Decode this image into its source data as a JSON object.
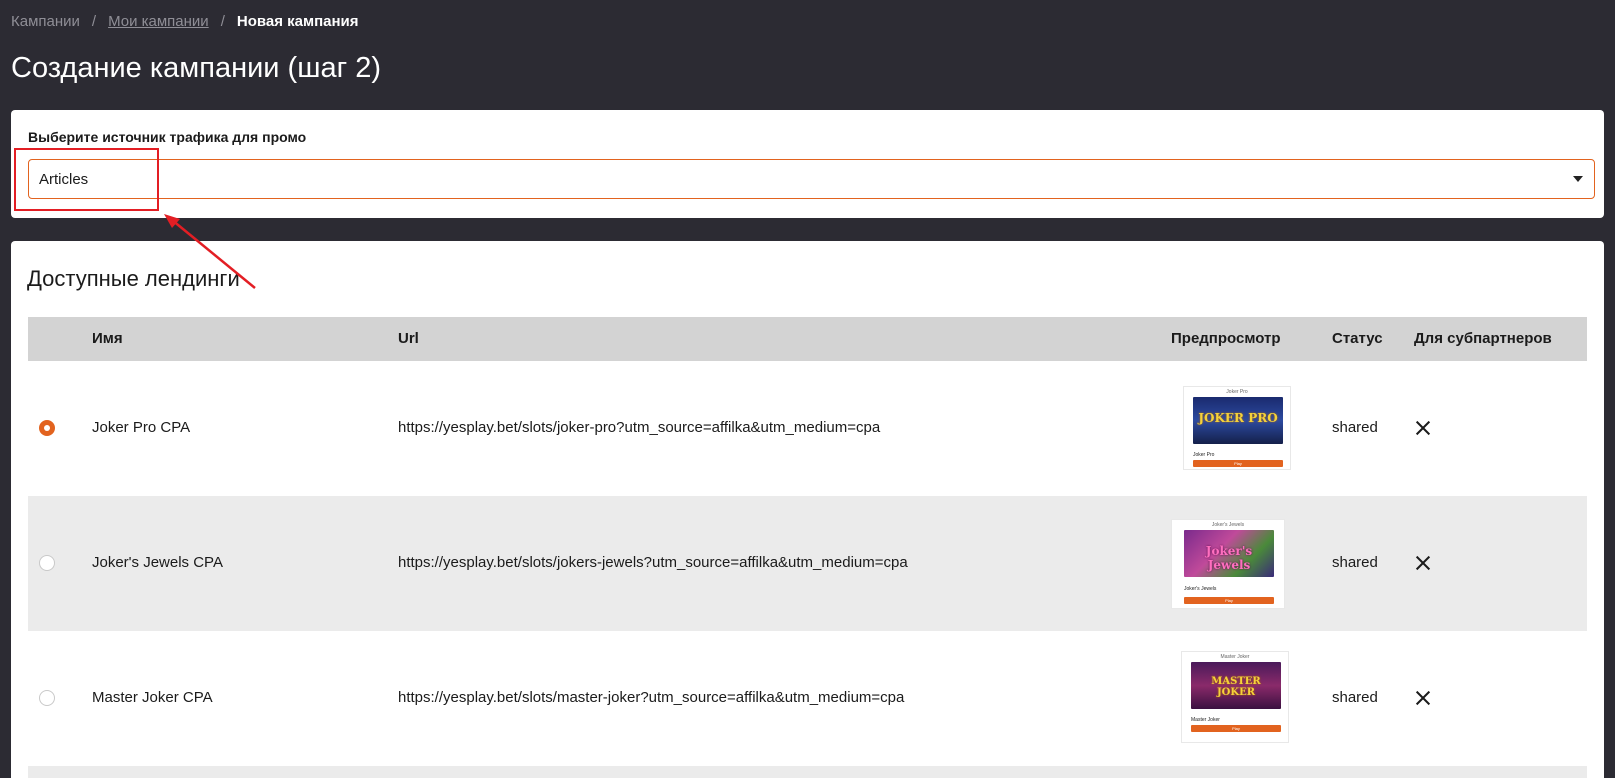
{
  "breadcrumb": {
    "items": [
      "Кампании",
      "Мои кампании",
      "Новая кампания"
    ],
    "separator": "/"
  },
  "page_title": "Создание кампании (шаг 2)",
  "traffic_source": {
    "label": "Выберите источник трафика для промо",
    "selected_value": "Articles",
    "accent_color": "#e2631f"
  },
  "landings": {
    "title": "Доступные лендинги",
    "columns": [
      "Имя",
      "Url",
      "Предпросмотр",
      "Статус",
      "Для субпартнеров"
    ],
    "rows": [
      {
        "selected": true,
        "name": "Joker Pro CPA",
        "url": "https://yesplay.bet/slots/joker-pro?utm_source=affilka&utm_medium=cpa",
        "preview": {
          "title": "Joker Pro",
          "name": "Joker Pro",
          "button": "Play",
          "logo": "JOKER PRO"
        },
        "status": "shared",
        "subpartners_icon": "close-icon"
      },
      {
        "selected": false,
        "name": "Joker's Jewels CPA",
        "url": "https://yesplay.bet/slots/jokers-jewels?utm_source=affilka&utm_medium=cpa",
        "preview": {
          "title": "Joker's Jewels",
          "name": "Joker's Jewels",
          "button": "Play",
          "logo": "Joker's Jewels"
        },
        "status": "shared",
        "subpartners_icon": "close-icon"
      },
      {
        "selected": false,
        "name": "Master Joker CPA",
        "url": "https://yesplay.bet/slots/master-joker?utm_source=affilka&utm_medium=cpa",
        "preview": {
          "title": "Master Joker",
          "name": "Master Joker",
          "button": "Play",
          "logo": "MASTER JOKER"
        },
        "status": "shared",
        "subpartners_icon": "close-icon"
      }
    ]
  },
  "annotation_color": "#e31e24"
}
